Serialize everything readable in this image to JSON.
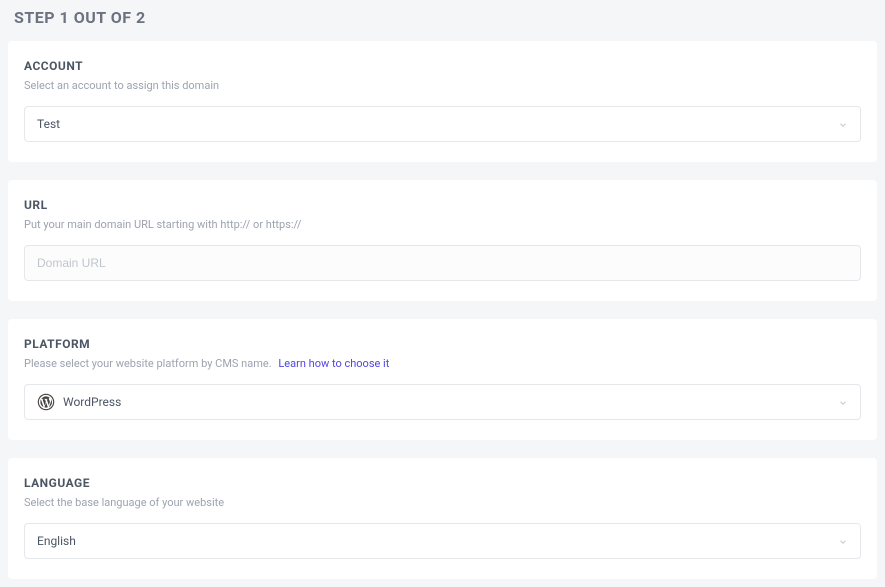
{
  "page": {
    "step_title": "STEP 1 OUT OF 2"
  },
  "account": {
    "title": "ACCOUNT",
    "desc": "Select an account to assign this domain",
    "value": "Test"
  },
  "url": {
    "title": "URL",
    "desc": "Put your main domain URL starting with http:// or https://",
    "placeholder": "Domain URL",
    "value": ""
  },
  "platform": {
    "title": "PLATFORM",
    "desc": "Please select your website platform by CMS name.",
    "link": "Learn how to choose it",
    "value": "WordPress"
  },
  "language": {
    "title": "LANGUAGE",
    "desc": "Select the base language of your website",
    "value": "English"
  }
}
